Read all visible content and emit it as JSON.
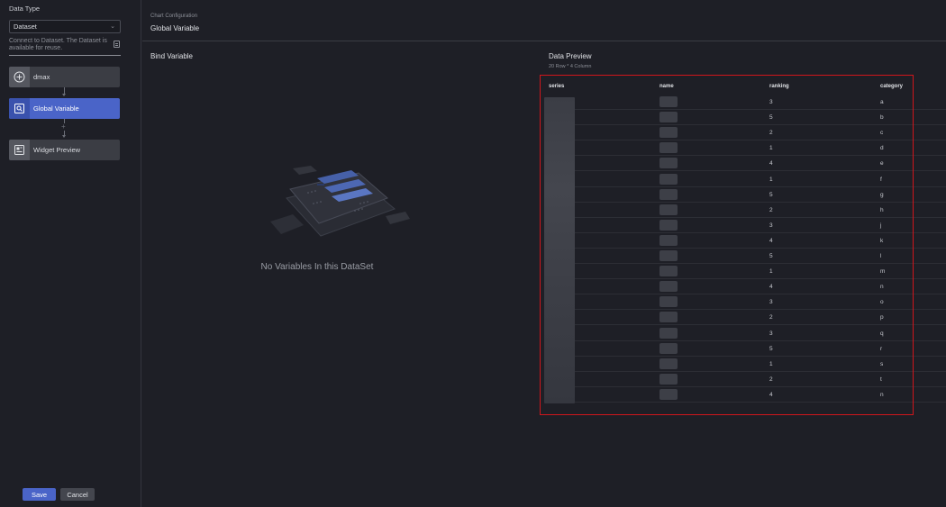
{
  "left": {
    "data_type_label": "Data Type",
    "select_value": "Dataset",
    "description": "Connect to Dataset. The Dataset is available for reuse.",
    "steps": [
      {
        "label": "dmax",
        "icon": "plus-circle-icon"
      },
      {
        "label": "Global Variable",
        "icon": "global-variable-icon"
      },
      {
        "label": "Widget Preview",
        "icon": "widget-preview-icon"
      }
    ],
    "save_label": "Save",
    "cancel_label": "Cancel"
  },
  "main": {
    "breadcrumb": "Chart Configuration",
    "title": "Global Variable",
    "bind_variable_title": "Bind Variable",
    "empty_text": "No Variables In this DataSet"
  },
  "preview": {
    "title": "Data Preview",
    "subtitle": "20 Row * 4 Column",
    "columns": [
      "series",
      "name",
      "ranking",
      "category"
    ],
    "rows": [
      {
        "ranking": "3",
        "category": "a"
      },
      {
        "ranking": "5",
        "category": "b"
      },
      {
        "ranking": "2",
        "category": "c"
      },
      {
        "ranking": "1",
        "category": "d"
      },
      {
        "ranking": "4",
        "category": "e"
      },
      {
        "ranking": "1",
        "category": "f"
      },
      {
        "ranking": "5",
        "category": "g"
      },
      {
        "ranking": "2",
        "category": "h"
      },
      {
        "ranking": "3",
        "category": "j"
      },
      {
        "ranking": "4",
        "category": "k"
      },
      {
        "ranking": "5",
        "category": "l"
      },
      {
        "ranking": "1",
        "category": "m"
      },
      {
        "ranking": "4",
        "category": "n"
      },
      {
        "ranking": "3",
        "category": "o"
      },
      {
        "ranking": "2",
        "category": "p"
      },
      {
        "ranking": "3",
        "category": "q"
      },
      {
        "ranking": "5",
        "category": "r"
      },
      {
        "ranking": "1",
        "category": "s"
      },
      {
        "ranking": "2",
        "category": "t"
      },
      {
        "ranking": "4",
        "category": "n"
      }
    ]
  },
  "colors": {
    "accent": "#4a64c8",
    "highlight_border": "#d0161c",
    "background": "#1e1f26"
  }
}
